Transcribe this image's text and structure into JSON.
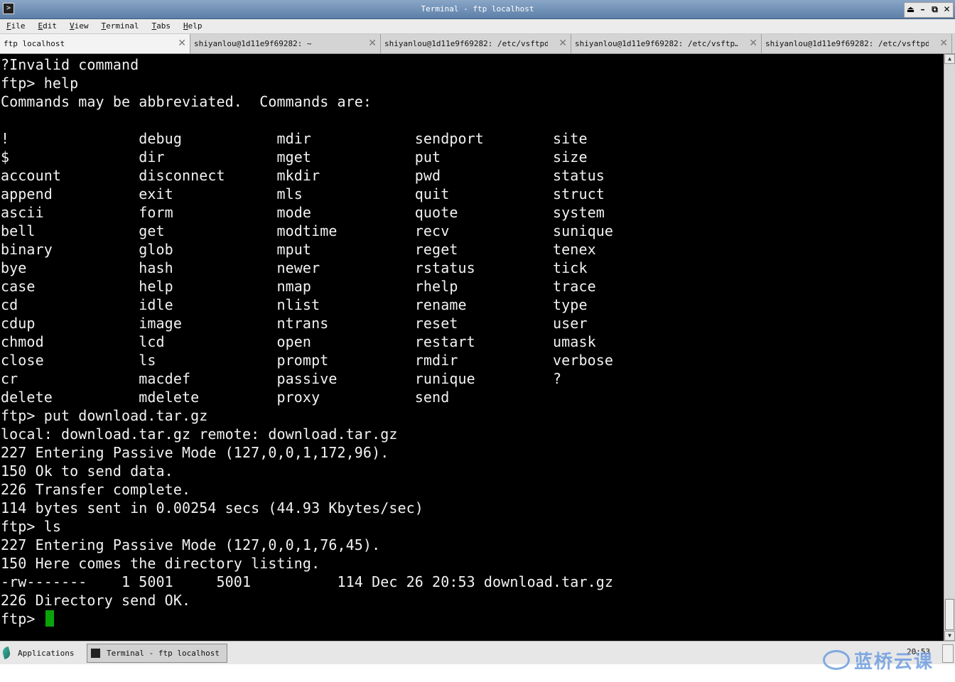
{
  "window": {
    "title": "Terminal - ftp localhost",
    "controls": [
      "⏏",
      "–",
      "⧉",
      "✕"
    ]
  },
  "menubar": {
    "items": [
      {
        "accel": "F",
        "rest": "ile"
      },
      {
        "accel": "E",
        "rest": "dit"
      },
      {
        "accel": "V",
        "rest": "iew"
      },
      {
        "accel": "T",
        "rest": "erminal"
      },
      {
        "accel": "T",
        "rest": "abs"
      },
      {
        "accel": "H",
        "rest": "elp"
      }
    ]
  },
  "tabs": [
    {
      "label": "ftp localhost",
      "active": true
    },
    {
      "label": "shiyanlou@1d11e9f69282: ~",
      "active": false
    },
    {
      "label": "shiyanlou@1d11e9f69282: /etc/vsftpd",
      "active": false
    },
    {
      "label": "shiyanlou@1d11e9f69282: /etc/vsftp…",
      "active": false
    },
    {
      "label": "shiyanlou@1d11e9f69282: /etc/vsftpd",
      "active": false
    }
  ],
  "terminal": {
    "lines": [
      "?Invalid command",
      "ftp> help",
      "Commands may be abbreviated.  Commands are:",
      "",
      "!               debug           mdir            sendport        site",
      "$               dir             mget            put             size",
      "account         disconnect      mkdir           pwd             status",
      "append          exit            mls             quit            struct",
      "ascii           form            mode            quote           system",
      "bell            get             modtime         recv            sunique",
      "binary          glob            mput            reget           tenex",
      "bye             hash            newer           rstatus         tick",
      "case            help            nmap            rhelp           trace",
      "cd              idle            nlist           rename          type",
      "cdup            image           ntrans          reset           user",
      "chmod           lcd             open            restart         umask",
      "close           ls              prompt          rmdir           verbose",
      "cr              macdef          passive         runique         ?",
      "delete          mdelete         proxy           send",
      "ftp> put download.tar.gz",
      "local: download.tar.gz remote: download.tar.gz",
      "227 Entering Passive Mode (127,0,0,1,172,96).",
      "150 Ok to send data.",
      "226 Transfer complete.",
      "114 bytes sent in 0.00254 secs (44.93 Kbytes/sec)",
      "ftp> ls",
      "227 Entering Passive Mode (127,0,0,1,76,45).",
      "150 Here comes the directory listing.",
      "-rw-------    1 5001     5001          114 Dec 26 20:53 download.tar.gz",
      "226 Directory send OK."
    ],
    "prompt": "ftp> "
  },
  "panel": {
    "applications_label": "Applications",
    "task_label": "Terminal - ftp localhost",
    "clock": "20:53"
  },
  "watermark": {
    "text": "蓝桥云课"
  },
  "colors": {
    "terminal_bg": "#000000",
    "terminal_fg": "#f2f2f2",
    "cursor": "#0aa40a",
    "titlebar": "#6a8bb3"
  }
}
